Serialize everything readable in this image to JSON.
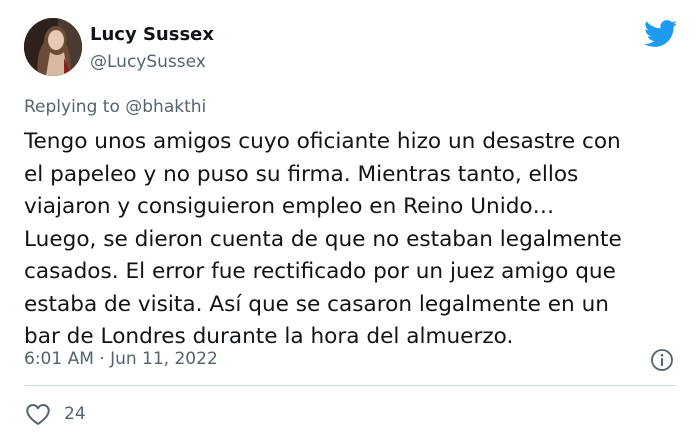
{
  "author": {
    "name": "Lucy Sussex",
    "handle": "@LucySussex",
    "avatar_icon": "profile-portrait"
  },
  "brand": {
    "icon": "twitter-bird-icon",
    "color": "#1d9bf0"
  },
  "reply": {
    "prefix": "Replying to",
    "mention": "@bhakthi"
  },
  "tweet": {
    "lines": [
      "Tengo unos amigos cuyo oficiante hizo un desastre con",
      "el papeleo y no puso su firma. Mientras tanto, ellos",
      "viajaron y consiguieron empleo en Reino Unido…",
      "Luego, se dieron cuenta de que no estaban legalmente",
      "casados. El error fue rectificado por un juez amigo que",
      "estaba de visita. Así que se casaron legalmente en un",
      "bar de Londres durante la hora del almuerzo."
    ]
  },
  "meta": {
    "timestamp": "6:01 AM · Jun 11, 2022",
    "info_icon": "info-icon"
  },
  "engagement": {
    "like_icon": "heart-icon",
    "like_count": "24"
  },
  "colors": {
    "text": "#0f1419",
    "secondary": "#536471",
    "divider": "#cfd9de"
  }
}
